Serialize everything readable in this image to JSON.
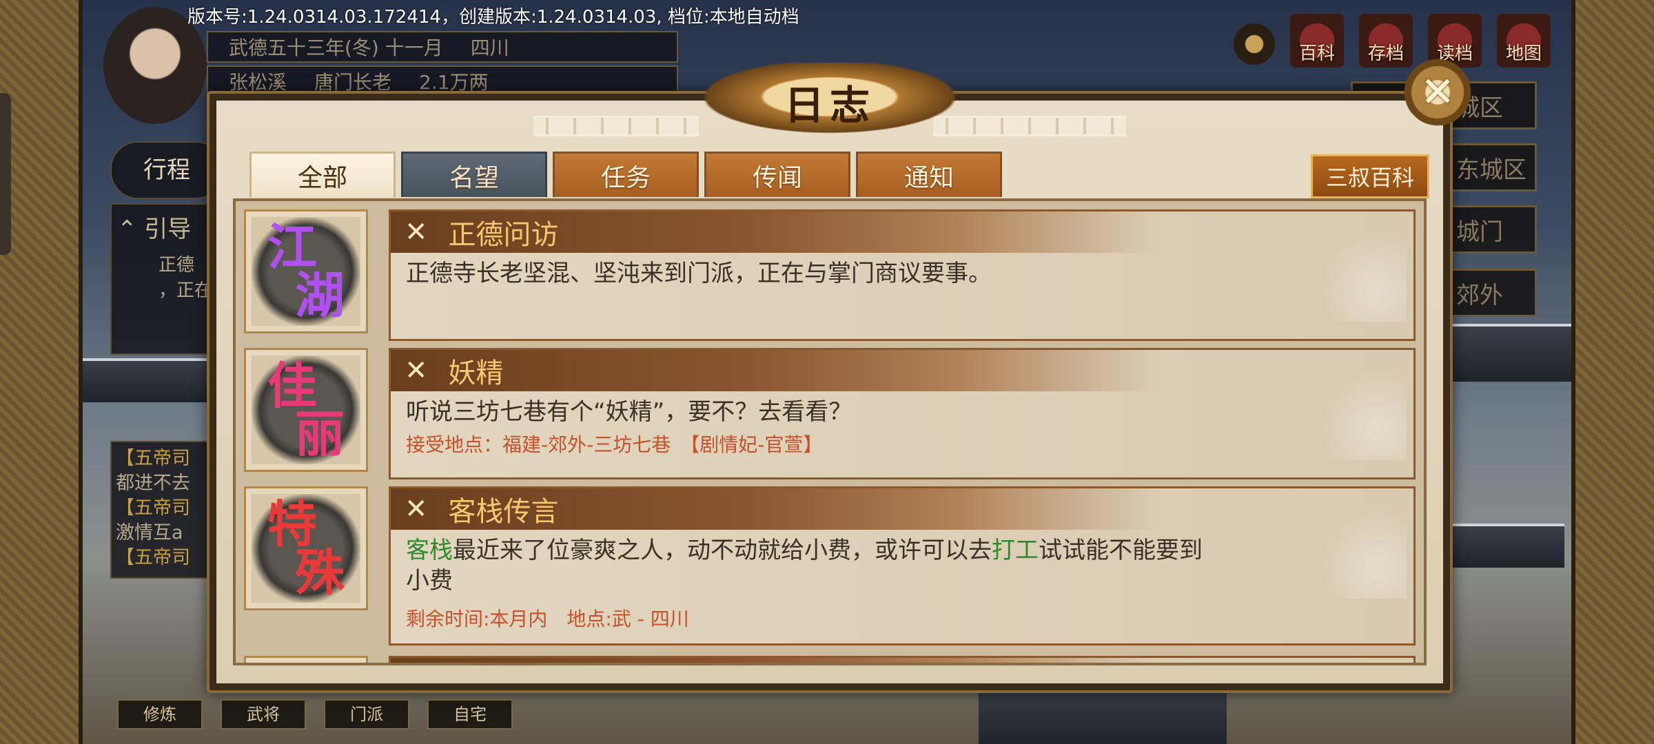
{
  "version_text": "版本号:1.24.0314.03.172414，创建版本:1.24.0314.03, 档位:本地自动档",
  "header_info": {
    "date": "武德五十三年(冬) 十一月",
    "region": "四川",
    "name": "张松溪",
    "rank": "唐门长老",
    "money": "2.1万两"
  },
  "top_icons": [
    "百科",
    "存档",
    "读档",
    "地图"
  ],
  "side_buttons": [
    "城区",
    "东城区",
    "城门",
    "郊外"
  ],
  "left_panel": {
    "guide_label": "引导",
    "guide_lines": [
      "正德",
      "，正在"
    ],
    "chat_lines": [
      "【五帝司",
      "都进不去",
      "【五帝司",
      "激情互a",
      "【五帝司"
    ],
    "badge": "行程"
  },
  "bottom_buttons": [
    "修炼",
    "武将",
    "门派",
    "自宅"
  ],
  "dialog": {
    "title": "日志",
    "close": "✕",
    "tabs": [
      "全部",
      "名望",
      "任务",
      "传闻",
      "通知"
    ],
    "wiki_button": "三叔百科",
    "entries": [
      {
        "emblem": [
          "江",
          "湖"
        ],
        "emblem_color": "#a040e0",
        "title": "正德问访",
        "body": "正德寺长老坚混、坚沌来到门派，正在与掌门商议要事。",
        "sub": ""
      },
      {
        "emblem": [
          "佳",
          "丽"
        ],
        "emblem_color": "#e0306a",
        "title": "妖精",
        "body": "听说三坊七巷有个“妖精”，要不？去看看？",
        "sub": "接受地点：福建-郊外-三坊七巷　【剧情妃-官萱】"
      },
      {
        "emblem": [
          "特",
          "殊"
        ],
        "emblem_color": "#e03030",
        "title": "客栈传言",
        "body_parts": [
          "客栈",
          "最近来了位豪爽之人，动不动就给小费，或许可以去",
          "打工",
          "试试能不能要到小费"
        ],
        "sub": "剩余时间:本月内　地点:武 - 四川"
      }
    ]
  }
}
